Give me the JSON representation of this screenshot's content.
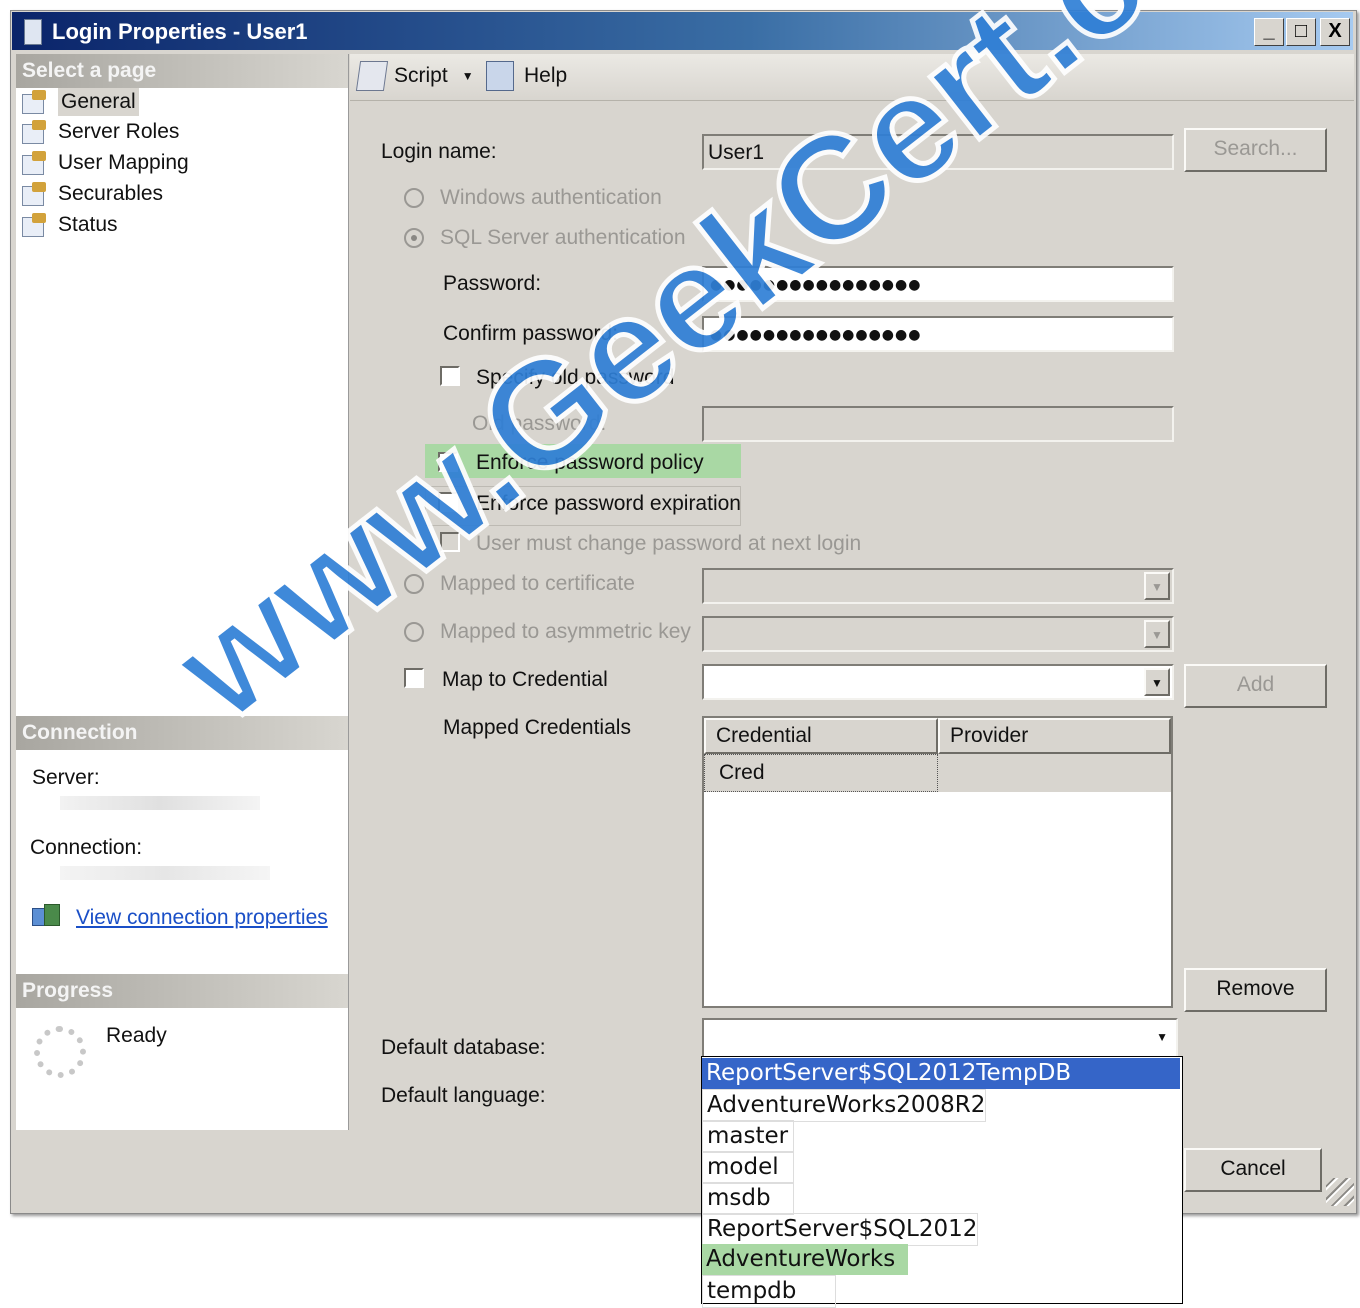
{
  "window": {
    "title": "Login Properties - User1",
    "minimize": "_",
    "maximize": "□",
    "close": "X"
  },
  "left": {
    "select_page_header": "Select a page",
    "pages": [
      {
        "label": "General",
        "icon": "page-wrench-icon",
        "selected": true
      },
      {
        "label": "Server Roles",
        "icon": "page-wrench-icon"
      },
      {
        "label": "User Mapping",
        "icon": "page-wrench-icon"
      },
      {
        "label": "Securables",
        "icon": "page-wrench-icon"
      },
      {
        "label": "Status",
        "icon": "page-wrench-icon"
      }
    ],
    "connection_header": "Connection",
    "server_label": "Server:",
    "connection_label": "Connection:",
    "view_connection_link": "View connection properties",
    "progress_header": "Progress",
    "progress_status": "Ready"
  },
  "toolbar": {
    "script_label": "Script",
    "help_label": "Help"
  },
  "form": {
    "login_name_label": "Login name:",
    "login_name_value": "User1",
    "search_button": "Search...",
    "windows_auth_label": "Windows authentication",
    "sql_auth_label": "SQL Server authentication",
    "password_label": "Password:",
    "password_value": "●●●●●●●●●●●●●●●●",
    "confirm_password_label": "Confirm password:",
    "confirm_password_value": "●●●●●●●●●●●●●●●●",
    "specify_old_password_label": "Specify old password",
    "old_password_label": "Old password:",
    "enforce_policy_label": "Enforce password policy",
    "enforce_expiration_label": "Enforce password expiration",
    "must_change_label": "User must change password at next login",
    "mapped_certificate_label": "Mapped to certificate",
    "mapped_asym_key_label": "Mapped to asymmetric key",
    "map_credential_label": "Map to Credential",
    "add_button": "Add",
    "mapped_credentials_label": "Mapped Credentials",
    "grid_columns": [
      "Credential",
      "Provider"
    ],
    "grid_rows": [
      [
        "Cred",
        ""
      ]
    ],
    "remove_button": "Remove",
    "default_database_label": "Default database:",
    "default_language_label": "Default language:",
    "cancel_button": "Cancel"
  },
  "dropdown": {
    "options": [
      "ReportServer$SQL2012TempDB",
      "AdventureWorks2008R2",
      "master",
      "model",
      "msdb",
      "ReportServer$SQL2012",
      "AdventureWorks",
      "tempdb"
    ],
    "highlighted_index": 0,
    "green_index": 6
  },
  "watermark": "www.GeekCert.com",
  "colors": {
    "selection_blue": "#3565c8",
    "highlight_green": "#a9d8a4",
    "title_dark": "#0a246a",
    "link_blue": "#1a4fc7"
  }
}
